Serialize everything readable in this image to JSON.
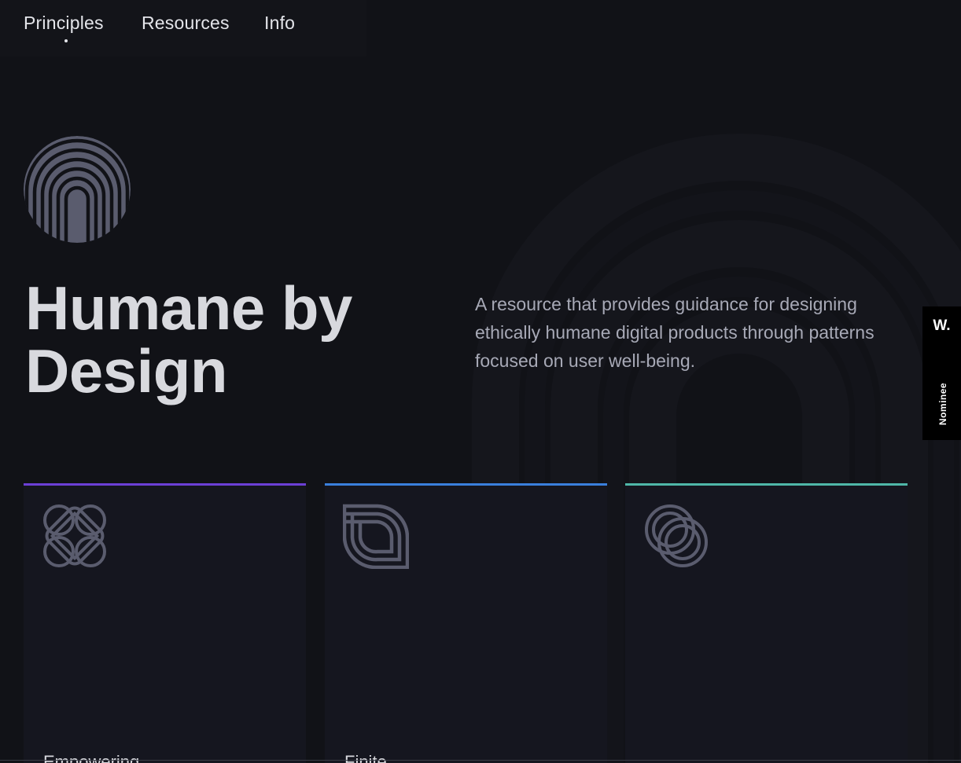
{
  "nav": {
    "items": [
      {
        "label": "Principles",
        "active": true
      },
      {
        "label": "Resources"
      },
      {
        "label": "Info"
      }
    ]
  },
  "hero": {
    "title_line1": "Humane by",
    "title_line2": "Design",
    "description": "A resource that provides guidance for designing ethically humane digital products through patterns focused on user well-being."
  },
  "cards": [
    {
      "label": "Empowering",
      "accent": "#6c3fd6",
      "icon": "interlock-square-icon"
    },
    {
      "label": "Finite",
      "accent": "#3a7fdc",
      "icon": "stacked-arc-icon"
    },
    {
      "label": "",
      "accent": "#4fb7a8",
      "icon": "linked-rings-icon"
    }
  ],
  "badge": {
    "mark": "W.",
    "text": "Nominee"
  },
  "colors": {
    "background": "#111217",
    "card": "#15161f",
    "icon": "#5a5c6e"
  }
}
